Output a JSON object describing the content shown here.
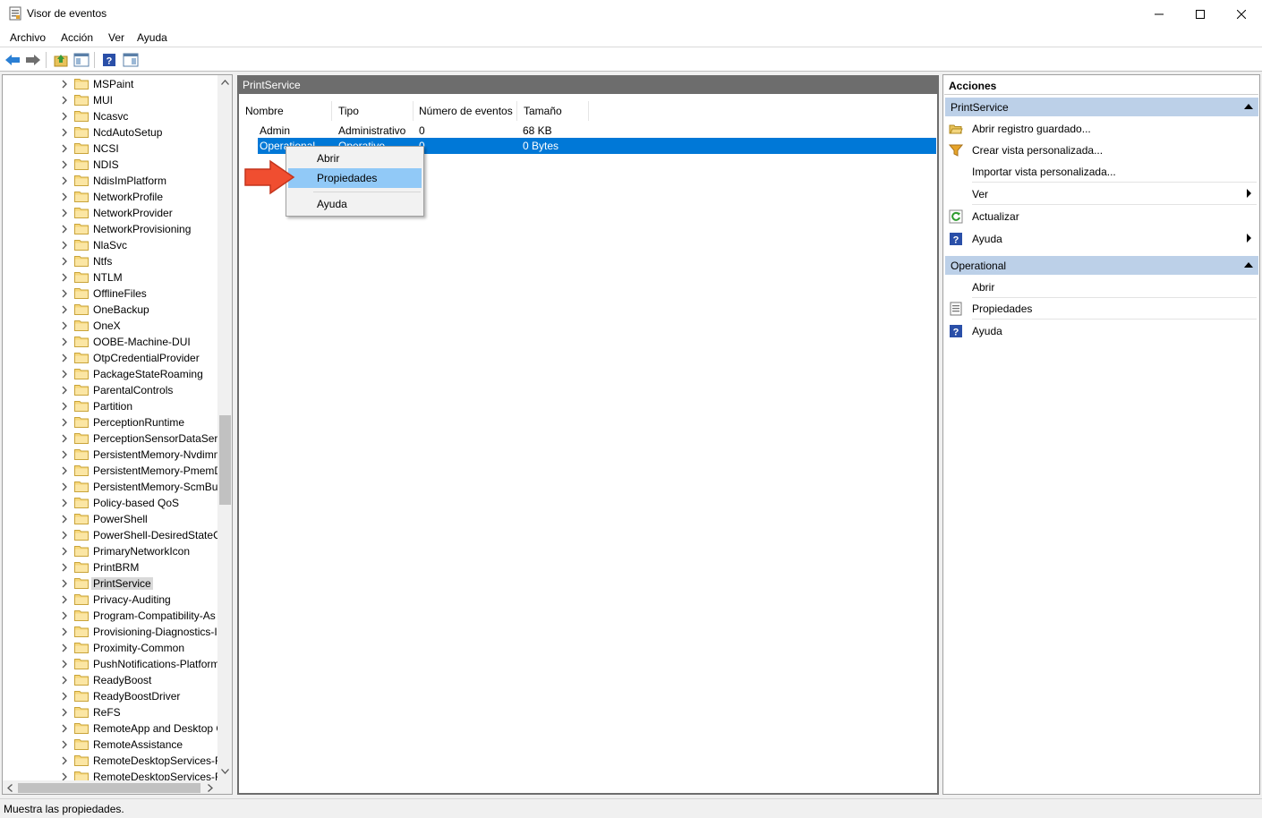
{
  "window": {
    "title": "Visor de eventos",
    "min": "minimize-icon",
    "max": "maximize-icon",
    "close": "close-icon"
  },
  "menu": [
    "Archivo",
    "Acción",
    "Ver",
    "Ayuda"
  ],
  "toolbar": [
    "back-arrow-icon",
    "forward-arrow-icon",
    "up-folder-icon",
    "show-hide-tree-icon",
    "help-icon",
    "show-hide-actions-icon"
  ],
  "tree": {
    "items": [
      "MSPaint",
      "MUI",
      "Ncasvc",
      "NcdAutoSetup",
      "NCSI",
      "NDIS",
      "NdisImPlatform",
      "NetworkProfile",
      "NetworkProvider",
      "NetworkProvisioning",
      "NlaSvc",
      "Ntfs",
      "NTLM",
      "OfflineFiles",
      "OneBackup",
      "OneX",
      "OOBE-Machine-DUI",
      "OtpCredentialProvider",
      "PackageStateRoaming",
      "ParentalControls",
      "Partition",
      "PerceptionRuntime",
      "PerceptionSensorDataServ",
      "PersistentMemory-Nvdimm",
      "PersistentMemory-PmemD",
      "PersistentMemory-ScmBus",
      "Policy-based QoS",
      "PowerShell",
      "PowerShell-DesiredStateCo",
      "PrimaryNetworkIcon",
      "PrintBRM",
      "PrintService",
      "Privacy-Auditing",
      "Program-Compatibility-As",
      "Provisioning-Diagnostics-I",
      "Proximity-Common",
      "PushNotifications-Platform",
      "ReadyBoost",
      "ReadyBoostDriver",
      "ReFS",
      "RemoteApp and Desktop C",
      "RemoteAssistance",
      "RemoteDesktopServices-R",
      "RemoteDesktopServices-R"
    ],
    "selected": "PrintService"
  },
  "center": {
    "title": "PrintService",
    "columns": [
      "Nombre",
      "Tipo",
      "Número de eventos",
      "Tamaño"
    ],
    "rows": [
      {
        "name": "Admin",
        "type": "Administrativo",
        "count": "0",
        "size": "68 KB"
      },
      {
        "name": "Operational",
        "type": "Operativo",
        "count": "0",
        "size": "0 Bytes"
      }
    ]
  },
  "context_menu": {
    "items": [
      "Abrir",
      "Propiedades",
      "Ayuda"
    ],
    "highlighted": "Propiedades"
  },
  "actions": {
    "title": "Acciones",
    "section1": {
      "title": "PrintService",
      "items": [
        "Abrir registro guardado...",
        "Crear vista personalizada...",
        "Importar vista personalizada...",
        "Ver",
        "Actualizar",
        "Ayuda"
      ]
    },
    "section2": {
      "title": "Operational",
      "items": [
        "Abrir",
        "Propiedades",
        "Ayuda"
      ]
    }
  },
  "status": "Muestra las propiedades.",
  "colors": {
    "selection": "#0078d7",
    "menu_highlight": "#91c9f7",
    "section_header": "#bcd0e8",
    "pointer_arrow": "#f04e30"
  }
}
